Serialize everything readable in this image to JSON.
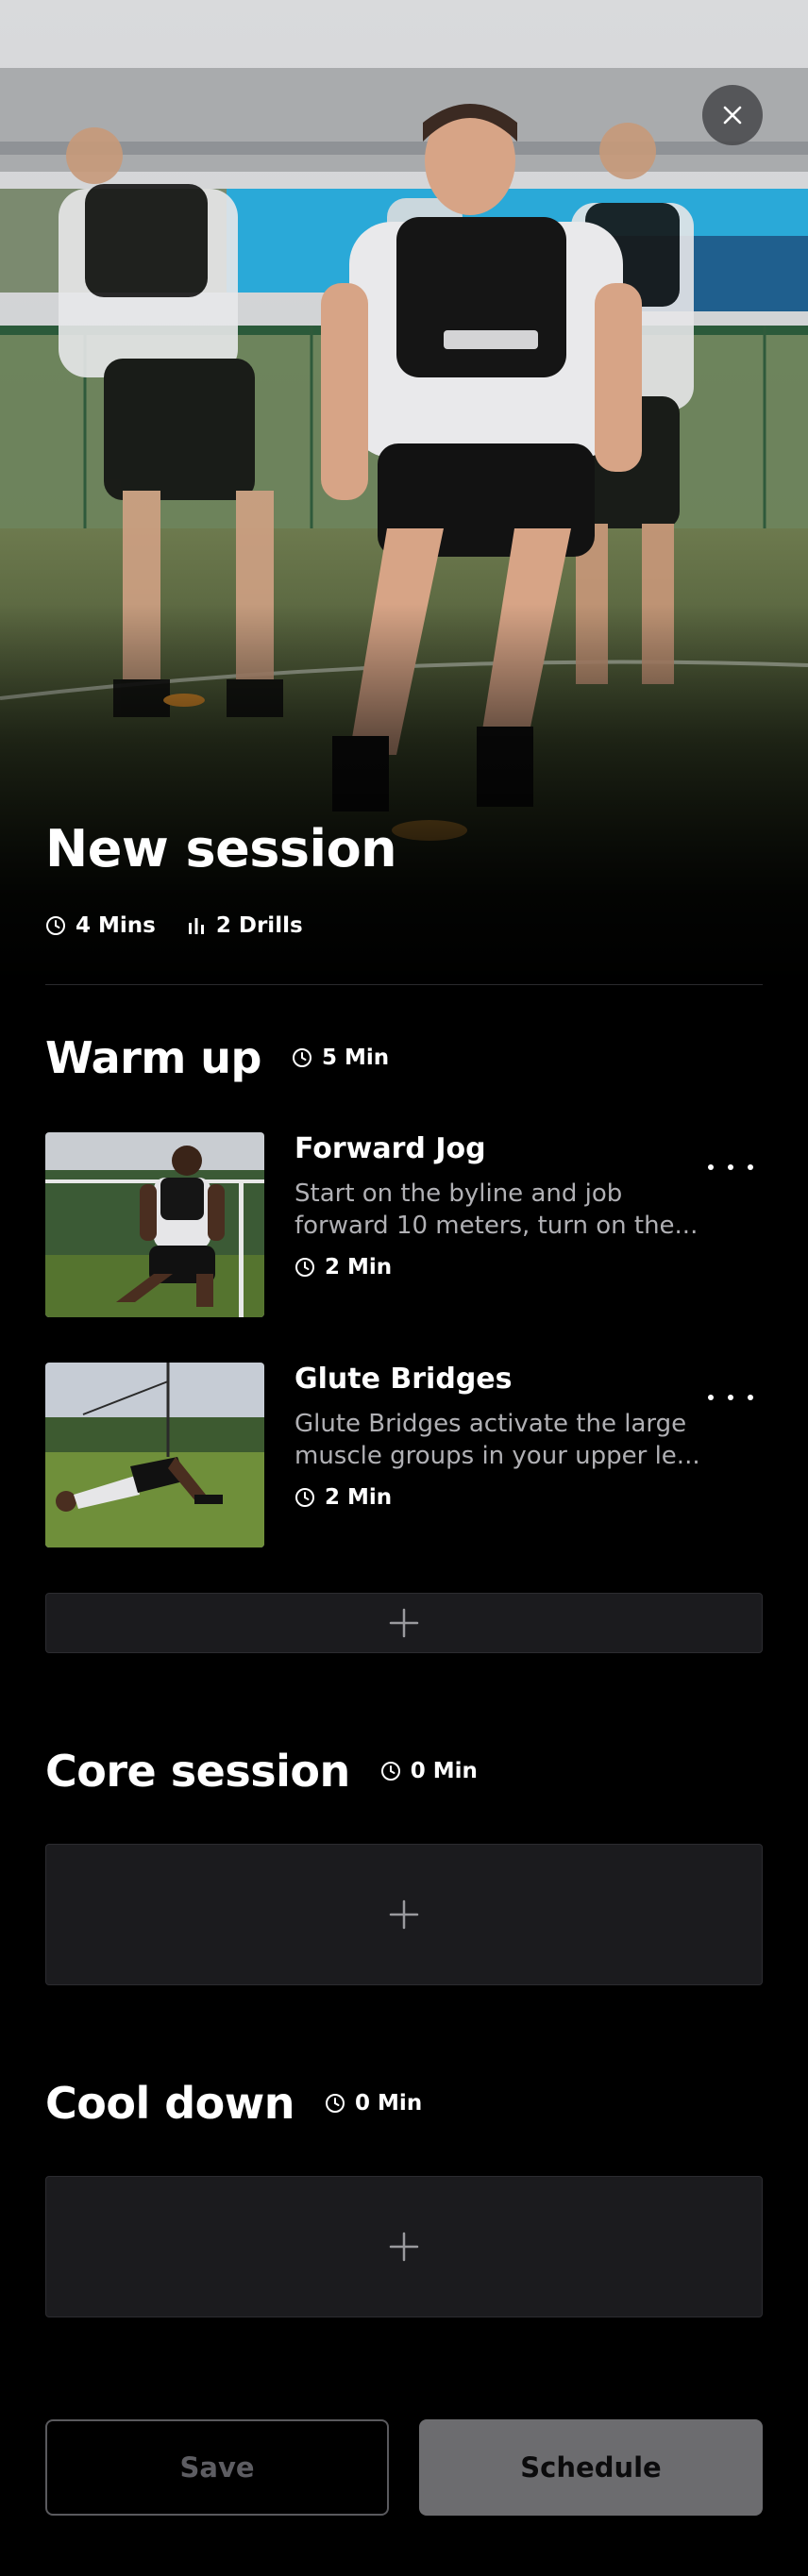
{
  "session": {
    "title": "New session",
    "total_duration": "4 Mins",
    "drill_count": "2 Drills"
  },
  "sections": [
    {
      "title": "Warm up",
      "duration": "5 Min",
      "drills": [
        {
          "name": "Forward Jog",
          "description": "Start on the byline and job forward 10 meters, turn on the...",
          "duration": "2 Min"
        },
        {
          "name": "Glute Bridges",
          "description": "Glute Bridges activate the large muscle groups in your upper le...",
          "duration": "2 Min"
        }
      ]
    },
    {
      "title": "Core session",
      "duration": "0 Min",
      "drills": []
    },
    {
      "title": "Cool down",
      "duration": "0 Min",
      "drills": []
    }
  ],
  "footer": {
    "save_label": "Save",
    "schedule_label": "Schedule"
  },
  "icons": {
    "close": "close-icon",
    "clock": "clock-icon",
    "drills": "bar-chart-icon",
    "more": "more-horizontal-icon",
    "add": "plus-icon"
  },
  "colors": {
    "background": "#000000",
    "card": "#1b1b1e",
    "muted_text": "#b0b0b4",
    "disabled_button": "#6c6c6f"
  }
}
